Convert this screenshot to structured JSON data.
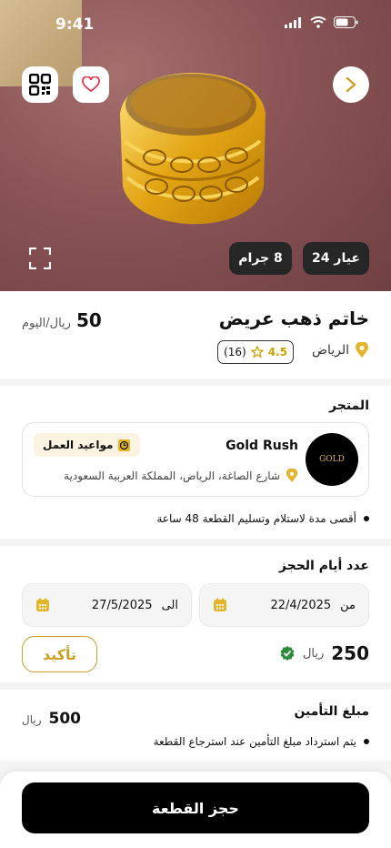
{
  "status_bar": {
    "time": "9:41"
  },
  "product": {
    "title": "خاتم ذهب عريض",
    "price": "50",
    "price_unit": "ريال/اليوم",
    "location": "الرياض",
    "rating": "4.5",
    "reviews": "(16)",
    "karat": "عيار 24",
    "weight": "8 جرام"
  },
  "store": {
    "section_label": "المتجر",
    "name": "Gold Rush",
    "logo_text": "GOLD",
    "address": "شارع الصاغة، الرياض، المملكة العربية السعودية",
    "hours_label": "مواعيد العمل",
    "note": "أقصى مدة لاستلام وتسليم القطعة 48 ساعة"
  },
  "booking": {
    "section_label": "عدد أيام الحجز",
    "from_label": "من",
    "from_date": "22/4/2025",
    "to_label": "الى",
    "to_date": "27/5/2025",
    "total": "250",
    "total_unit": "ريال",
    "confirm_label": "تأكيد"
  },
  "insurance": {
    "label": "مبلغ التأمين",
    "amount": "500",
    "unit": "ريال",
    "note": "يتم استرداد مبلغ التأمين عند استرجاع القطعة"
  },
  "cta": {
    "label": "حجز القطعة"
  },
  "colors": {
    "gold": "#c9a020",
    "dark_chip": "#262626",
    "success": "#2e8b3a"
  }
}
